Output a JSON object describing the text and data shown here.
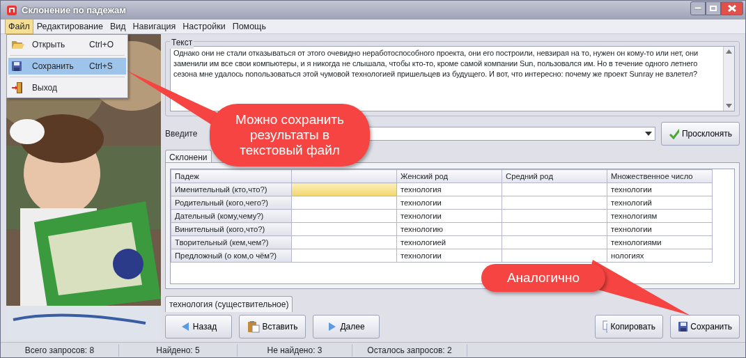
{
  "window": {
    "title": "Склонение по падежам"
  },
  "menu": [
    {
      "label": "Файл",
      "selected": true
    },
    {
      "label": "Редактирование",
      "selected": false
    },
    {
      "label": "Вид",
      "selected": false
    },
    {
      "label": "Навигация",
      "selected": false
    },
    {
      "label": "Настройки",
      "selected": false
    },
    {
      "label": "Помощь",
      "selected": false
    }
  ],
  "file_menu": [
    {
      "kind": "open",
      "label": "Открыть",
      "shortcut": "Ctrl+O",
      "selected": false
    },
    {
      "kind": "save",
      "label": "Сохранить",
      "shortcut": "Ctrl+S",
      "selected": true
    },
    {
      "kind": "exit",
      "label": "Выход",
      "selected": false
    }
  ],
  "text_group": {
    "label": "Текст",
    "value": "Однако они не стали отказываться от этого очевидно неработоспособного проекта, они его построили, невзирая на то, нужен он кому-то или нет, они заменили им все свои компьютеры, и я никогда не слышала, чтобы кто-то, кроме самой компании Sun, пользовался им. Но в течение одного летнего сезона мне удалось попользоваться этой чумовой технологией пришельцев из будущего. И вот, что интересно: почему же проект Sunray не взлетел?"
  },
  "word_input": {
    "label": "Введите"
  },
  "decline_button": "Просклонять",
  "declension_tab": "Склонени",
  "table": {
    "columns": [
      {
        "label": "Падеж"
      },
      {},
      {
        "label": "Женский род"
      },
      {
        "label": "Средний род"
      },
      {
        "label": "Множественное число"
      }
    ],
    "rows": [
      {
        "case": "Именительный (кто,что?)",
        "cells": [
          {
            "selected": true
          },
          {
            "text": "технология",
            "selected": false
          },
          {
            "selected": false
          },
          {
            "text": "технологии",
            "selected": false
          }
        ]
      },
      {
        "case": "Родительный (кого,чего?)",
        "cells": [
          {
            "selected": false
          },
          {
            "text": "технологии",
            "selected": false
          },
          {
            "selected": false
          },
          {
            "text": "технологий",
            "selected": false
          }
        ]
      },
      {
        "case": "Дательный (кому,чему?)",
        "cells": [
          {
            "selected": false
          },
          {
            "text": "технологии",
            "selected": false
          },
          {
            "selected": false
          },
          {
            "text": "технологиям",
            "selected": false
          }
        ]
      },
      {
        "case": "Винительный (кого,что?)",
        "cells": [
          {
            "selected": false
          },
          {
            "text": "технологию",
            "selected": false
          },
          {
            "selected": false
          },
          {
            "text": "технологии",
            "selected": false
          }
        ]
      },
      {
        "case": "Творительный (кем,чем?)",
        "cells": [
          {
            "selected": false
          },
          {
            "text": "технологией",
            "selected": false
          },
          {
            "selected": false
          },
          {
            "text": "технологиями",
            "selected": false
          }
        ]
      },
      {
        "case": "Предложный (о ком,о чём?)",
        "cells": [
          {
            "selected": false
          },
          {
            "text": "технологии",
            "selected": false
          },
          {
            "selected": false
          },
          {
            "text": "нологиях",
            "selected": false
          }
        ]
      }
    ]
  },
  "word_tab": "технология (существительное)",
  "nav_buttons": [
    {
      "kind": "back",
      "label": "Назад"
    },
    {
      "kind": "paste",
      "label": "Вставить"
    },
    {
      "kind": "next",
      "label": "Далее"
    }
  ],
  "action_buttons": [
    {
      "kind": "copy",
      "label": "Копировать"
    },
    {
      "kind": "save",
      "label": "Сохранить"
    }
  ],
  "status_bar": [
    "Всего запросов: 8",
    "Найдено: 5",
    "Не найдено: 3",
    "Осталось запросов: 2"
  ],
  "callouts": [
    {
      "kind": "save_menu",
      "text": "Можно сохранить результаты в текстовый файл"
    },
    {
      "kind": "save_button",
      "text": "Аналогично"
    }
  ]
}
